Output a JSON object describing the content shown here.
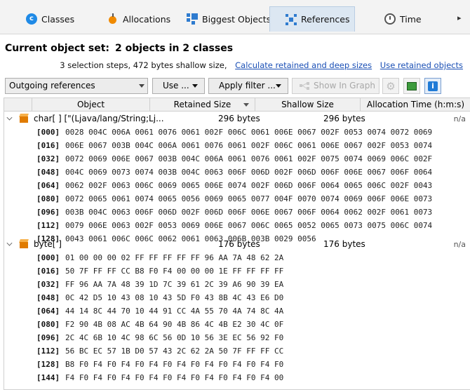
{
  "tabs": [
    {
      "label": "Classes",
      "icon": "classes-icon"
    },
    {
      "label": "Allocations",
      "icon": "allocations-icon"
    },
    {
      "label": "Biggest Objects",
      "icon": "biggest-objects-icon"
    },
    {
      "label": "References",
      "icon": "references-icon",
      "active": true
    },
    {
      "label": "Time",
      "icon": "clock-icon"
    }
  ],
  "header": {
    "title_prefix": "Current object set:",
    "title_value": "2 objects in 2 classes",
    "steps_text": "3 selection steps, 472 bytes shallow size,",
    "link_calc": "Calculate retained and deep sizes",
    "link_use": "Use retained objects"
  },
  "toolbar": {
    "mode": "Outgoing references",
    "use_label": "Use ...",
    "filter_label": "Apply filter ...",
    "graph_label": "Show In Graph"
  },
  "columns": {
    "object": "Object",
    "retained": "Retained Size",
    "shallow": "Shallow Size",
    "alloc": "Allocation Time (h:m:s)"
  },
  "objects": [
    {
      "name": "char[ ] [\"(Ljava/lang/String;Lj...",
      "retained": "296 bytes",
      "shallow": "296 bytes",
      "alloc": "n/a",
      "rows": [
        {
          "idx": "[000]",
          "vals": "0028 004C 006A 0061 0076 0061 002F 006C 0061 006E 0067 002F 0053 0074 0072 0069"
        },
        {
          "idx": "[016]",
          "vals": "006E 0067 003B 004C 006A 0061 0076 0061 002F 006C 0061 006E 0067 002F 0053 0074"
        },
        {
          "idx": "[032]",
          "vals": "0072 0069 006E 0067 003B 004C 006A 0061 0076 0061 002F 0075 0074 0069 006C 002F"
        },
        {
          "idx": "[048]",
          "vals": "004C 0069 0073 0074 003B 004C 0063 006F 006D 002F 006D 006F 006E 0067 006F 0064"
        },
        {
          "idx": "[064]",
          "vals": "0062 002F 0063 006C 0069 0065 006E 0074 002F 006D 006F 0064 0065 006C 002F 0043"
        },
        {
          "idx": "[080]",
          "vals": "0072 0065 0061 0074 0065 0056 0069 0065 0077 004F 0070 0074 0069 006F 006E 0073"
        },
        {
          "idx": "[096]",
          "vals": "003B 004C 0063 006F 006D 002F 006D 006F 006E 0067 006F 0064 0062 002F 0061 0073"
        },
        {
          "idx": "[112]",
          "vals": "0079 006E 0063 002F 0053 0069 006E 0067 006C 0065 0052 0065 0073 0075 006C 0074"
        },
        {
          "idx": "[128]",
          "vals": "0043 0061 006C 006C 0062 0061 0063 006B 003B 0029 0056"
        }
      ]
    },
    {
      "name": "byte[ ]",
      "retained": "176 bytes",
      "shallow": "176 bytes",
      "alloc": "n/a",
      "rows": [
        {
          "idx": "[000]",
          "vals": "01 00 00 00 02 FF FF FF FF FF 96 AA 7A 48 62 2A"
        },
        {
          "idx": "[016]",
          "vals": "50 7F FF FF CC B8 F0 F4 00 00 00 1E FF FF FF FF"
        },
        {
          "idx": "[032]",
          "vals": "FF 96 AA 7A 48 39 1D 7C 39 61 2C 39 A6 90 39 EA"
        },
        {
          "idx": "[048]",
          "vals": "0C 42 D5 10 43 08 10 43 5D F0 43 8B 4C 43 E6 D0"
        },
        {
          "idx": "[064]",
          "vals": "44 14 8C 44 70 10 44 91 CC 4A 55 70 4A 74 8C 4A"
        },
        {
          "idx": "[080]",
          "vals": "F2 90 4B 08 AC 4B 64 90 4B 86 4C 4B E2 30 4C 0F"
        },
        {
          "idx": "[096]",
          "vals": "2C 4C 6B 10 4C 98 6C 56 0D 10 56 3E EC 56 92 F0"
        },
        {
          "idx": "[112]",
          "vals": "56 BC EC 57 1B D0 57 43 2C 62 2A 50 7F FF FF CC"
        },
        {
          "idx": "[128]",
          "vals": "B8 F0 F4 F0 F4 F0 F4 F0 F4 F0 F4 F0 F4 F0 F4 F0"
        },
        {
          "idx": "[144]",
          "vals": "F4 F0 F4 F0 F4 F0 F4 F0 F4 F0 F4 F0 F4 F0 F4 00"
        }
      ]
    }
  ]
}
